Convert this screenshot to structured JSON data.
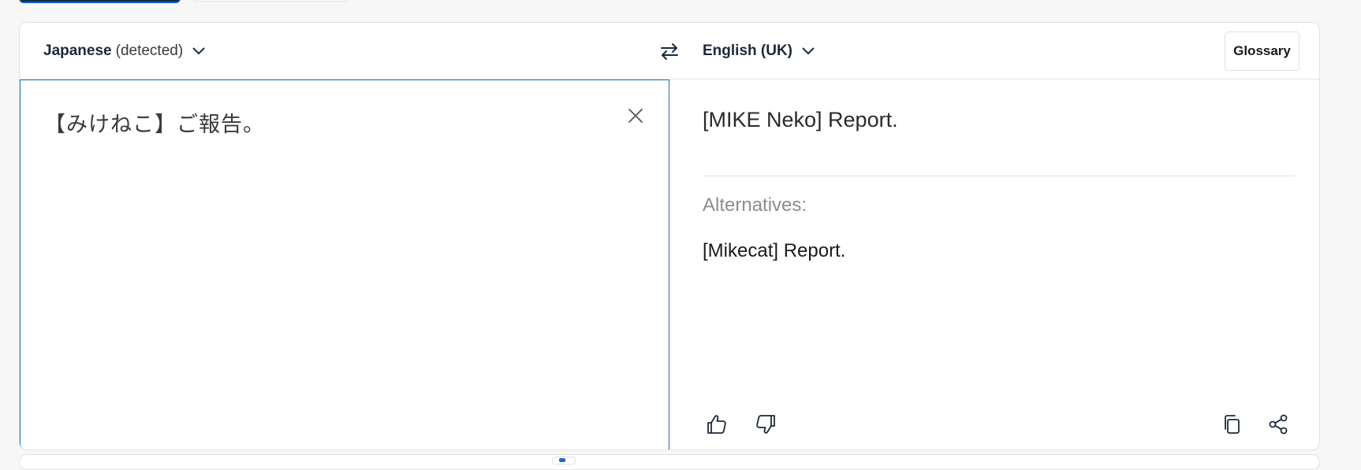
{
  "header": {
    "source_language": "Japanese",
    "source_hint": "(detected)",
    "target_language": "English (UK)",
    "glossary_label": "Glossary"
  },
  "source": {
    "text": "【みけねこ】ご報告。"
  },
  "target": {
    "translation": "[MIKE Neko] Report.",
    "alternatives_label": "Alternatives:",
    "alternatives": [
      "[Mikecat] Report."
    ]
  },
  "icons": {
    "swap": "swap-arrows-icon",
    "clear": "close-icon",
    "thumbs_up": "thumbs-up-icon",
    "thumbs_down": "thumbs-down-icon",
    "copy": "copy-icon",
    "share": "share-icon"
  },
  "colors": {
    "accent": "#1b6fb8",
    "dark_navy": "#0f2b46",
    "muted_text": "#8d8d8d"
  }
}
